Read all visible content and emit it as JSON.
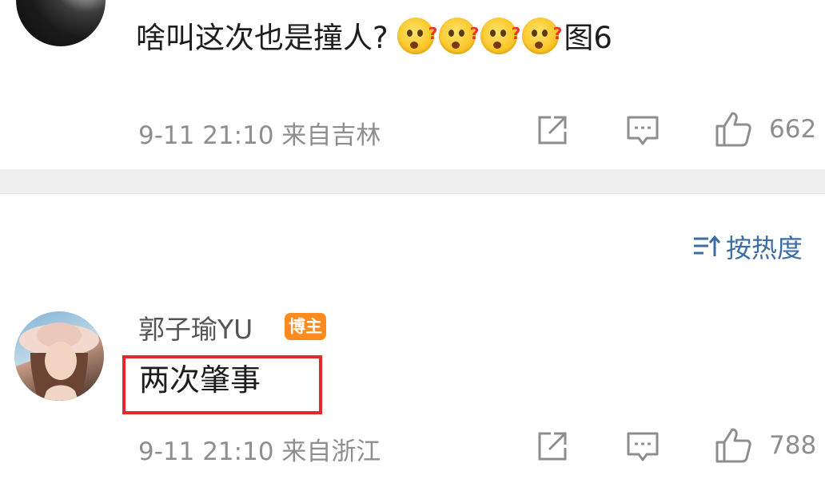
{
  "comments": [
    {
      "text": "啥叫这次也是撞人?",
      "emojis": [
        "confused-face-icon",
        "confused-face-icon",
        "confused-face-icon",
        "confused-face-icon"
      ],
      "text_suffix": "图6",
      "time": "9-11 21:10",
      "location": "来自吉林",
      "likes": "662"
    },
    {
      "username": "郭子瑜YU",
      "badge": "博主",
      "text": "两次肇事",
      "time": "9-11 21:10",
      "location": "来自浙江",
      "likes": "788"
    }
  ],
  "sort": {
    "label": "按热度"
  },
  "colors": {
    "accent": "#3a6ea5",
    "badge": "#ff8a1e",
    "highlight": "#e5282a",
    "meta": "#8e8e8e"
  }
}
